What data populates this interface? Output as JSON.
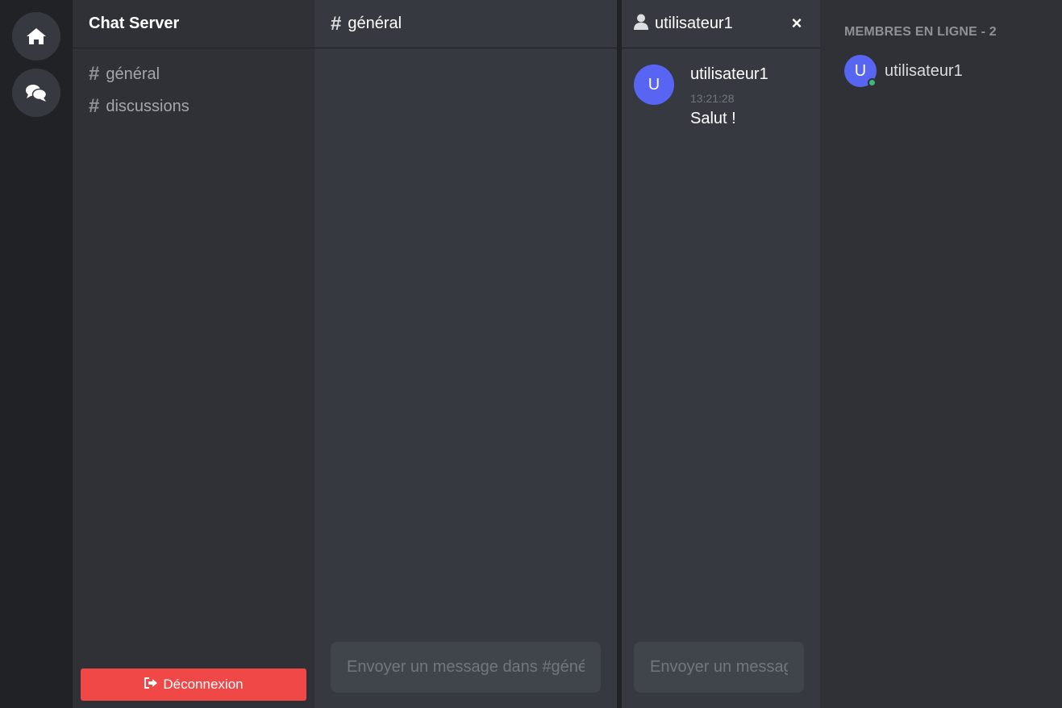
{
  "colors": {
    "rail_bg": "#202225",
    "sidebar_bg": "#2f3136",
    "panel_bg": "#36393f",
    "input_bg": "#40444b",
    "accent": "#5865f2",
    "danger": "#f04747",
    "online": "#43b581"
  },
  "rail": {
    "items": [
      {
        "icon": "home-icon"
      },
      {
        "icon": "chat-bubbles-icon"
      }
    ]
  },
  "sidebar": {
    "server_name": "Chat Server",
    "channels": [
      {
        "hash": "#",
        "label": "général"
      },
      {
        "hash": "#",
        "label": "discussions"
      }
    ],
    "logout_label": "Déconnexion",
    "logout_icon": "sign-out-icon"
  },
  "main": {
    "hash": "#",
    "channel_name": "général",
    "input_placeholder": "Envoyer un message dans #général"
  },
  "dm": {
    "icon": "user-icon",
    "title": "utilisateur1",
    "close_label": "×",
    "messages": [
      {
        "avatar_letter": "U",
        "author": "utilisateur1",
        "time": "13:21:28",
        "text": "Salut !"
      }
    ],
    "input_placeholder": "Envoyer un message"
  },
  "members": {
    "title": "MEMBRES EN LIGNE - 2",
    "list": [
      {
        "avatar_letter": "U",
        "name": "utilisateur1",
        "status": "online"
      }
    ]
  }
}
